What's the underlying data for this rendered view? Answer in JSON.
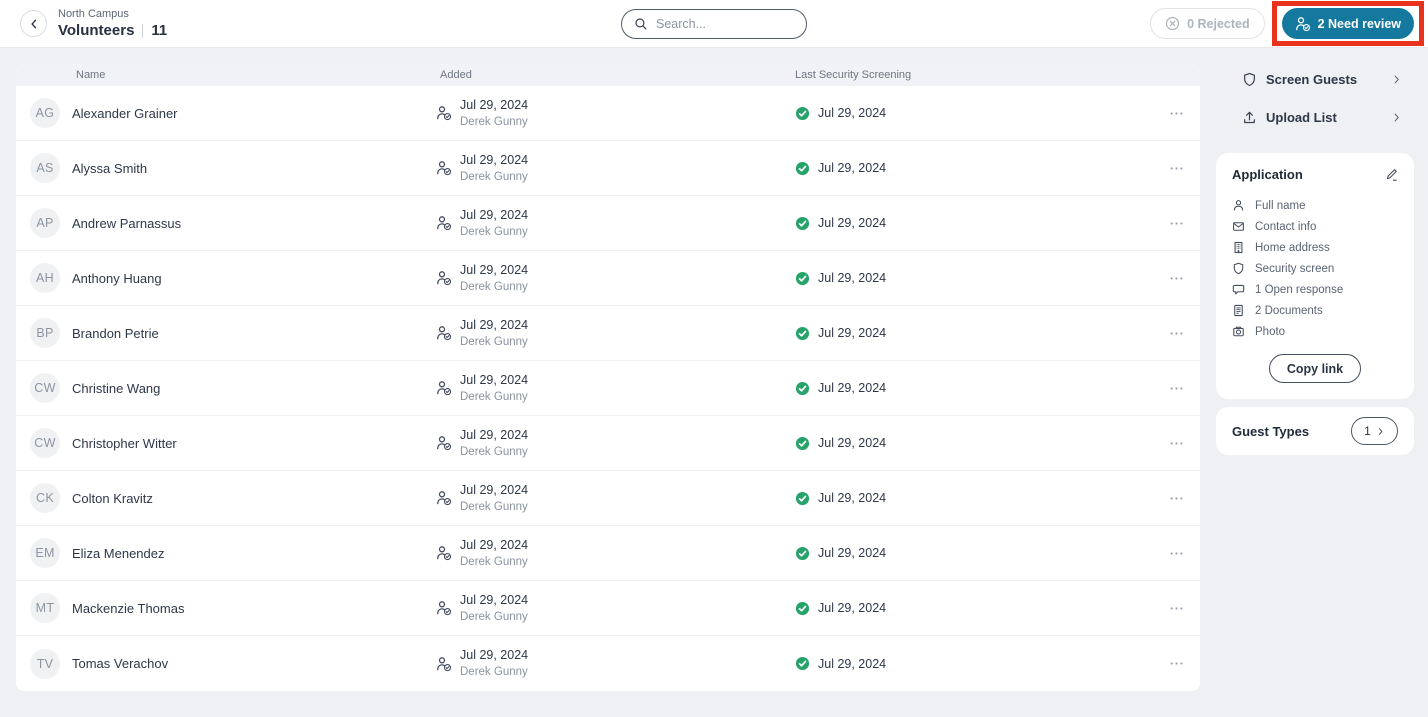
{
  "header": {
    "breadcrumb": "North Campus",
    "title": "Volunteers",
    "count": "11",
    "search": {
      "placeholder": "Search..."
    },
    "rejected_button": {
      "label": "0 Rejected"
    },
    "need_review_button": {
      "label": "2 Need review"
    }
  },
  "table": {
    "columns": {
      "name": "Name",
      "added": "Added",
      "screening": "Last Security Screening"
    },
    "rows": [
      {
        "initials": "AG",
        "name": "Alexander Grainer",
        "added_date": "Jul 29, 2024",
        "added_by": "Derek Gunny",
        "screening_date": "Jul 29, 2024"
      },
      {
        "initials": "AS",
        "name": "Alyssa Smith",
        "added_date": "Jul 29, 2024",
        "added_by": "Derek Gunny",
        "screening_date": "Jul 29, 2024"
      },
      {
        "initials": "AP",
        "name": "Andrew Parnassus",
        "added_date": "Jul 29, 2024",
        "added_by": "Derek Gunny",
        "screening_date": "Jul 29, 2024"
      },
      {
        "initials": "AH",
        "name": "Anthony Huang",
        "added_date": "Jul 29, 2024",
        "added_by": "Derek Gunny",
        "screening_date": "Jul 29, 2024"
      },
      {
        "initials": "BP",
        "name": "Brandon Petrie",
        "added_date": "Jul 29, 2024",
        "added_by": "Derek Gunny",
        "screening_date": "Jul 29, 2024"
      },
      {
        "initials": "CW",
        "name": "Christine Wang",
        "added_date": "Jul 29, 2024",
        "added_by": "Derek Gunny",
        "screening_date": "Jul 29, 2024"
      },
      {
        "initials": "CW",
        "name": "Christopher Witter",
        "added_date": "Jul 29, 2024",
        "added_by": "Derek Gunny",
        "screening_date": "Jul 29, 2024"
      },
      {
        "initials": "CK",
        "name": "Colton Kravitz",
        "added_date": "Jul 29, 2024",
        "added_by": "Derek Gunny",
        "screening_date": "Jul 29, 2024"
      },
      {
        "initials": "EM",
        "name": "Eliza Menendez",
        "added_date": "Jul 29, 2024",
        "added_by": "Derek Gunny",
        "screening_date": "Jul 29, 2024"
      },
      {
        "initials": "MT",
        "name": "Mackenzie Thomas",
        "added_date": "Jul 29, 2024",
        "added_by": "Derek Gunny",
        "screening_date": "Jul 29, 2024"
      },
      {
        "initials": "TV",
        "name": "Tomas Verachov",
        "added_date": "Jul 29, 2024",
        "added_by": "Derek Gunny",
        "screening_date": "Jul 29, 2024"
      }
    ]
  },
  "sidebar": {
    "screen_guests": {
      "label": "Screen Guests",
      "icon": "shield-icon"
    },
    "upload_list": {
      "label": "Upload List",
      "icon": "upload-icon"
    },
    "application": {
      "title": "Application",
      "edit_icon": "pencil-icon",
      "items": [
        {
          "icon": "person-icon",
          "label": "Full name"
        },
        {
          "icon": "envelope-icon",
          "label": "Contact info"
        },
        {
          "icon": "building-icon",
          "label": "Home address"
        },
        {
          "icon": "shield-icon",
          "label": "Security screen"
        },
        {
          "icon": "speech-bubble-icon",
          "label": "1 Open response"
        },
        {
          "icon": "document-icon",
          "label": "2 Documents"
        },
        {
          "icon": "camera-icon",
          "label": "Photo"
        }
      ],
      "copy_link_button": "Copy link"
    },
    "guest_types": {
      "title": "Guest Types",
      "count": "1"
    }
  },
  "colors": {
    "accent_teal": "#15799f",
    "success_green": "#27a36a",
    "annotation_red": "#e8321c",
    "page_background": "#eef0f3"
  }
}
